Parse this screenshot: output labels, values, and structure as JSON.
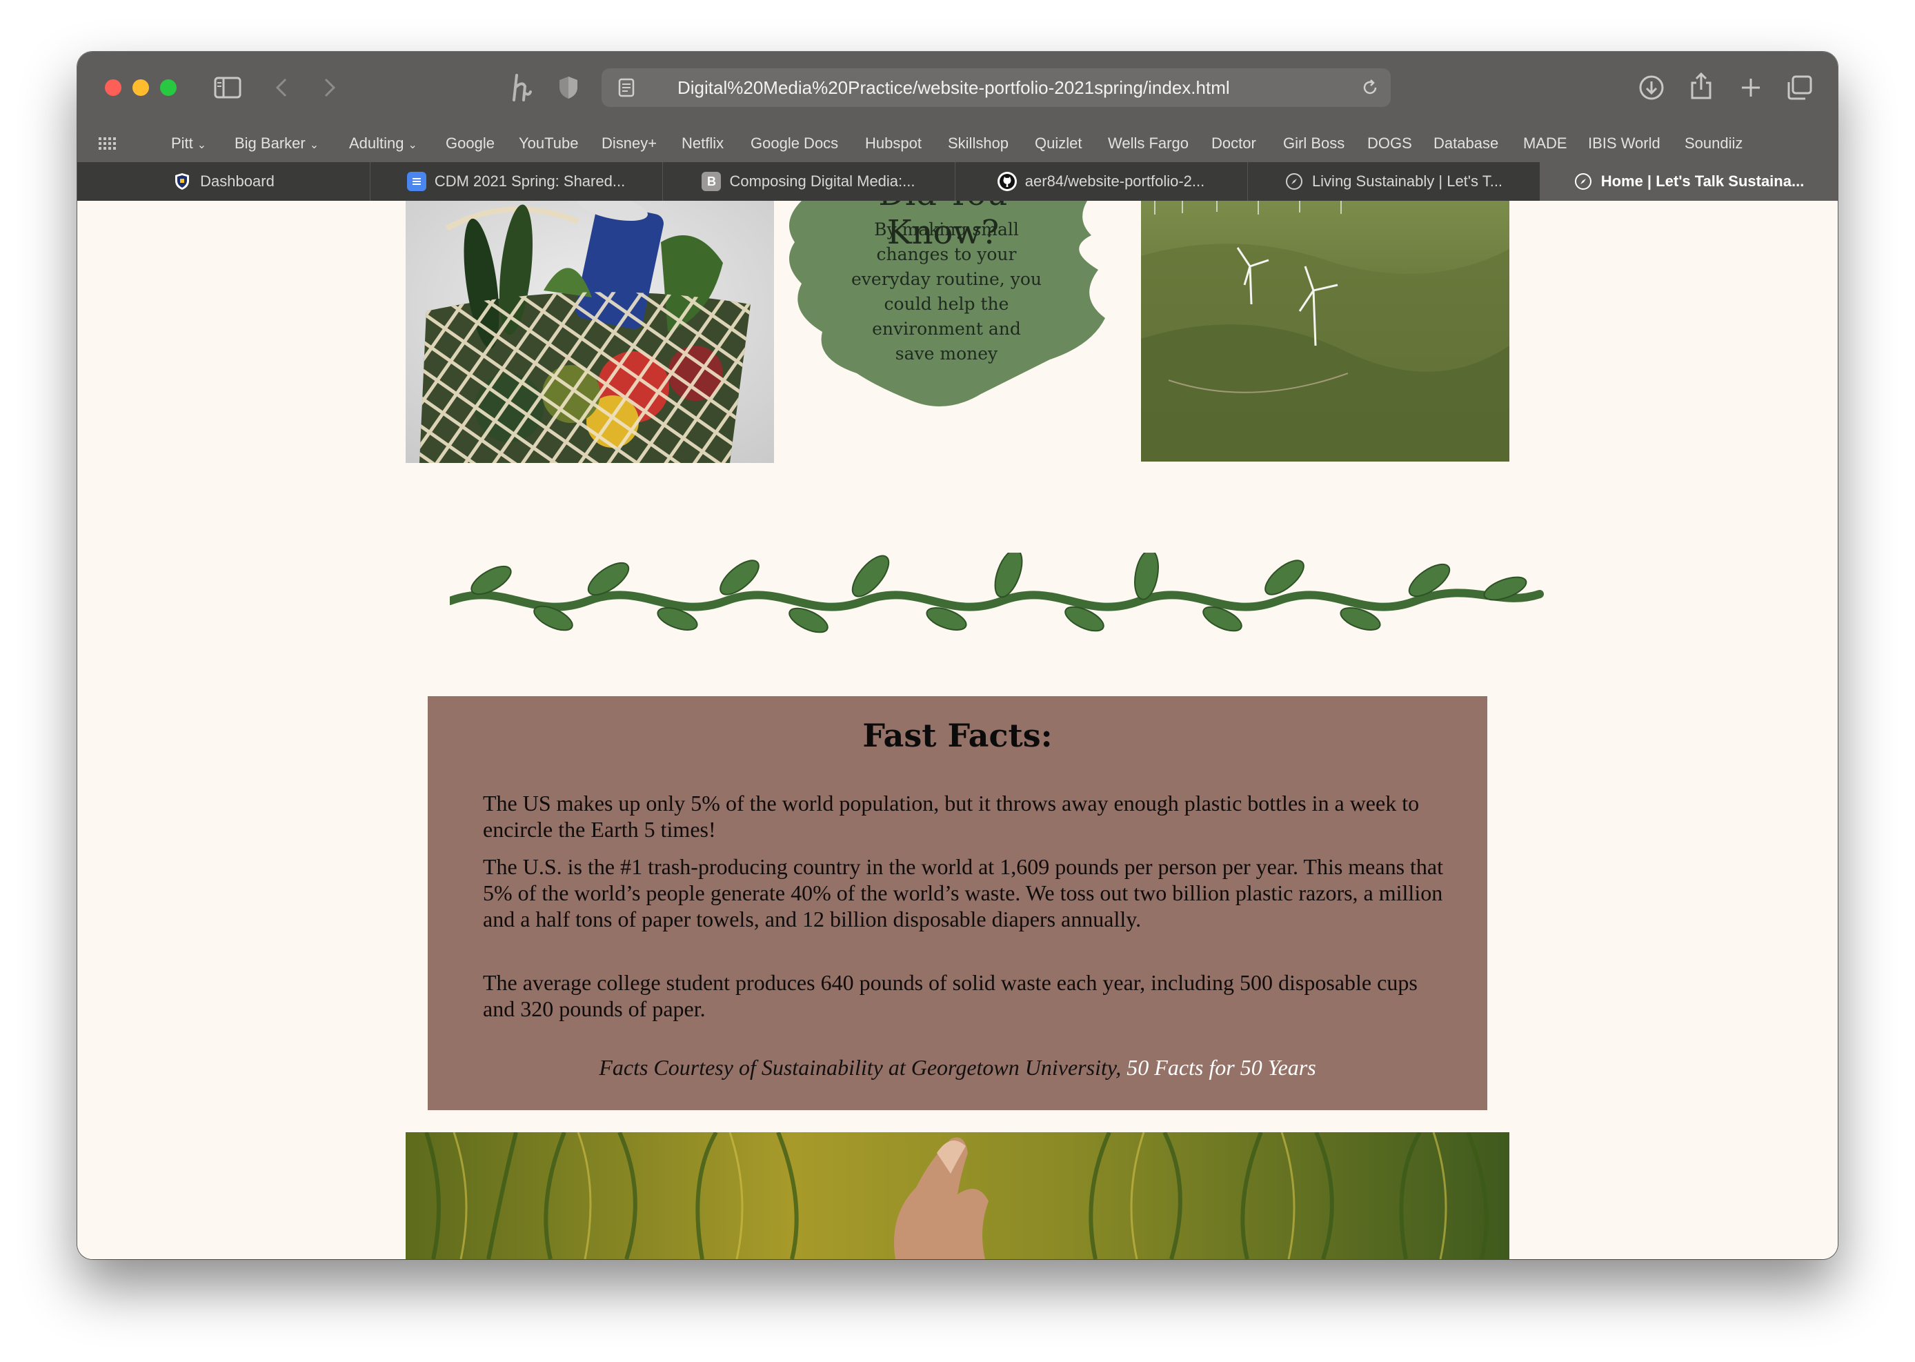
{
  "browser": {
    "url": "Digital%20Media%20Practice/website-portfolio-2021spring/index.html",
    "favorites": [
      {
        "label": "Pitt",
        "dropdown": true
      },
      {
        "label": "Big Barker",
        "dropdown": true
      },
      {
        "label": "Adulting",
        "dropdown": true
      },
      {
        "label": "Google",
        "dropdown": false
      },
      {
        "label": "YouTube",
        "dropdown": false
      },
      {
        "label": "Disney+",
        "dropdown": false
      },
      {
        "label": "Netflix",
        "dropdown": false
      },
      {
        "label": "Google Docs",
        "dropdown": false
      },
      {
        "label": "Hubspot",
        "dropdown": false
      },
      {
        "label": "Skillshop",
        "dropdown": false
      },
      {
        "label": "Quizlet",
        "dropdown": false
      },
      {
        "label": "Wells Fargo",
        "dropdown": false
      },
      {
        "label": "Doctor",
        "dropdown": false
      },
      {
        "label": "Girl Boss",
        "dropdown": false
      },
      {
        "label": "DOGS",
        "dropdown": false
      },
      {
        "label": "Database",
        "dropdown": false
      },
      {
        "label": "MADE",
        "dropdown": false
      },
      {
        "label": "IBIS World",
        "dropdown": false
      },
      {
        "label": "Soundiiz",
        "dropdown": false
      }
    ],
    "tabs": [
      {
        "label": "Dashboard",
        "icon": "pitt-shield-icon",
        "active": false
      },
      {
        "label": "CDM 2021 Spring: Shared...",
        "icon": "google-docs-icon",
        "active": false
      },
      {
        "label": "Composing Digital Media:...",
        "icon": "b-letter-icon",
        "active": false
      },
      {
        "label": "aer84/website-portfolio-2...",
        "icon": "github-icon",
        "active": false
      },
      {
        "label": "Living Sustainably | Let's T...",
        "icon": "compass-icon",
        "active": false
      },
      {
        "label": "Home | Let's Talk Sustaina...",
        "icon": "compass-icon",
        "active": true
      }
    ],
    "tab_b_letter": "B"
  },
  "page": {
    "did_you_know": {
      "heading": "Did You Know?",
      "body": "By making small changes to your everyday routine, you could help the environment and save money"
    },
    "fast_facts": {
      "title": "Fast Facts:",
      "facts": [
        "The US makes up only 5% of the world population, but it throws away enough plastic bottles in a week to encircle the Earth 5 times!",
        "The U.S. is the #1 trash-producing country in the world at 1,609 pounds per person per year. This means that 5% of the world’s people generate 40% of the world’s waste. We toss out two billion plastic razors, a million and a half tons of paper towels, and 12 billion disposable diapers annually.",
        "The average college student produces 640 pounds of solid waste each year, including 500 disposable cups and 320 pounds of paper."
      ],
      "credit_prefix": "Facts Courtesy of Sustainability at Georgetown University, ",
      "credit_link": "50 Facts for 50 Years"
    }
  },
  "colors": {
    "facts_box": "#957267",
    "blob_green": "#6a8a5e",
    "vine_green": "#3f6b35",
    "page_background": "#fdf9f2"
  }
}
